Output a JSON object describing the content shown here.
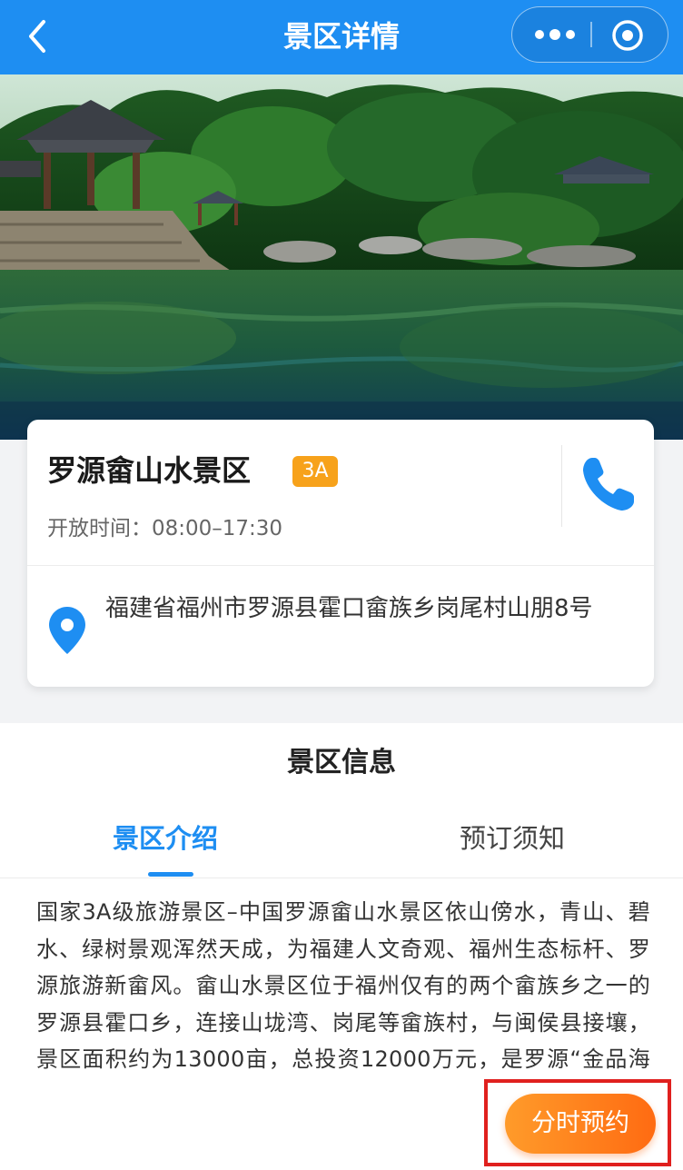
{
  "header": {
    "title": "景区详情",
    "back_icon": "chevron-left-icon",
    "more_icon": "more-dots-icon",
    "close_icon": "target-circle-icon",
    "bg_color": "#1e8ef2"
  },
  "hero": {
    "image": "scenic-lake-pavilion-photo"
  },
  "spot": {
    "name": "罗源畲山水景区",
    "level": "3A",
    "open_time": "开放时间：08:00–17:30",
    "address": "福建省福州市罗源县霍口畲族乡岗尾村山朋8号",
    "phone_icon": "phone-icon",
    "pin_icon": "location-pin-icon"
  },
  "info": {
    "section_title": "景区信息",
    "tabs": [
      {
        "label": "景区介绍",
        "active": true
      },
      {
        "label": "预订须知",
        "active": false
      }
    ],
    "intro": "国家3A级旅游景区–中国罗源畲山水景区依山傍水，青山、碧水、绿树景观浑然天成，为福建人文奇观、福州生态标杆、罗源旅游新畲风。畲山水景区位于福州仅有的两个畲族乡之一的罗源县霍口乡，连接山垅湾、岗尾等畲族村，与闽侯县接壤，景区面积约为13000亩，总投资12000万元，是罗源“金品海韵”旅游品牌的重要组成部分，为福"
  },
  "actions": {
    "book_label": "分时预约"
  },
  "colors": {
    "accent": "#1e8ef2",
    "badge": "#f7a21b",
    "book_button": "#ff7a18",
    "highlight_frame": "#e0201e"
  }
}
